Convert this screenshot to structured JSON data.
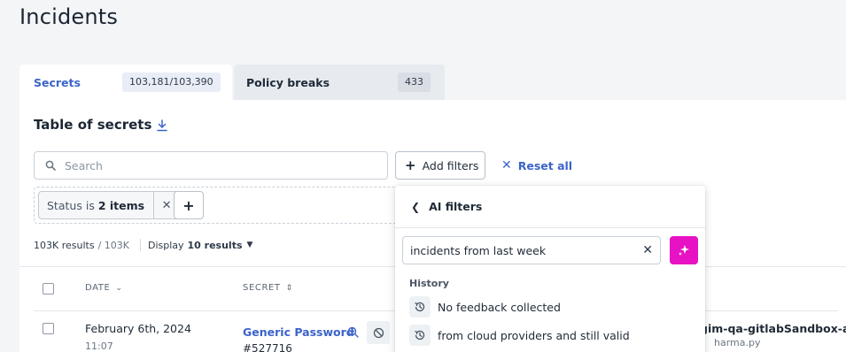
{
  "page": {
    "title": "Incidents"
  },
  "tabs": [
    {
      "label": "Secrets",
      "count": "103,181/103,390"
    },
    {
      "label": "Policy breaks",
      "count": "433"
    }
  ],
  "table": {
    "title": "Table of secrets",
    "search_placeholder": "Search",
    "add_filters_label": "Add filters",
    "reset_label": "Reset all",
    "filter_chip": {
      "field": "Status",
      "op": "is",
      "value": "2 items"
    },
    "results": {
      "count": "103K results",
      "total": "/ 103K",
      "display_label": "Display",
      "display_value": "10 results"
    },
    "columns": [
      {
        "label": "Date"
      },
      {
        "label": "Secret"
      }
    ],
    "rows": [
      {
        "date": "February 6th, 2024",
        "time": "11:07",
        "secret": "Generic Password",
        "id": "#527716",
        "repo": "gim-qa-gitlabSandbox-aut",
        "file": "harma.py"
      }
    ]
  },
  "ai_filters": {
    "title": "AI filters",
    "query": "incidents from last week",
    "history_title": "History",
    "history": [
      {
        "text": "No feedback collected"
      },
      {
        "text": "from cloud providers and still valid"
      }
    ],
    "accent_color": "#e612c3"
  },
  "colors": {
    "link": "#3b63c9",
    "background": "#f3f5f7"
  }
}
